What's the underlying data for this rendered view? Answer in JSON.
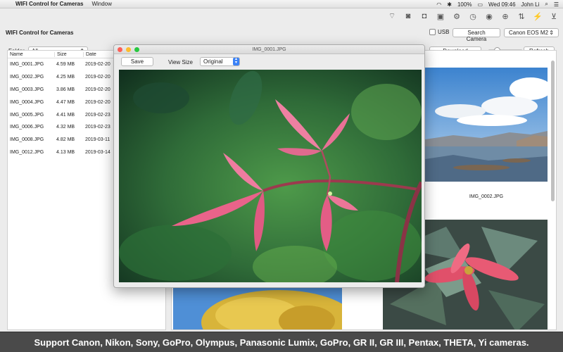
{
  "menubar": {
    "app_name": "WIFI Control for Cameras",
    "menus": [
      "Window"
    ],
    "battery": "100%",
    "clock": "Wed 09:46",
    "user": "John Li"
  },
  "window": {
    "title": "WIFI Control for Cameras",
    "usb_label": "USB",
    "search_camera_label": "Search Camera",
    "camera_selected": "Canon EOS M2",
    "folder_label": "Folder",
    "folder_selected": "All",
    "download_label": "Download Selected",
    "refresh_label": "Refresh",
    "zoom_slider_value": 0.2
  },
  "file_table": {
    "columns": [
      "Name",
      "Size",
      "Date"
    ],
    "rows": [
      {
        "name": "IMG_0001.JPG",
        "size": "4.59 MB",
        "date": "2019-02-20"
      },
      {
        "name": "IMG_0002.JPG",
        "size": "4.25 MB",
        "date": "2019-02-20"
      },
      {
        "name": "IMG_0003.JPG",
        "size": "3.86 MB",
        "date": "2019-02-20"
      },
      {
        "name": "IMG_0004.JPG",
        "size": "4.47 MB",
        "date": "2019-02-20"
      },
      {
        "name": "IMG_0005.JPG",
        "size": "4.41 MB",
        "date": "2019-02-23"
      },
      {
        "name": "IMG_0006.JPG",
        "size": "4.32 MB",
        "date": "2019-02-23"
      },
      {
        "name": "IMG_0008.JPG",
        "size": "4.82 MB",
        "date": "2019-03-11"
      },
      {
        "name": "IMG_0012.JPG",
        "size": "4.13 MB",
        "date": "2019-03-14"
      }
    ]
  },
  "grid": {
    "caption_2": "IMG_0002.JPG"
  },
  "viewer": {
    "title": "IMG_0001.JPG",
    "save_label": "Save",
    "view_size_label": "View Size",
    "view_size_value": "Original"
  },
  "banner": {
    "text": "Support Canon, Nikon, Sony, GoPro, Olympus, Panasonic Lumix, GoPro,  GR II, GR III, Pentax, THETA, Yi cameras."
  },
  "colors": {
    "accent": "#3b82f6",
    "close_light": "#fc5f57",
    "min_light": "#fdbc2e",
    "max_light": "#28c840",
    "banner_bg": "#4a4a4a"
  }
}
